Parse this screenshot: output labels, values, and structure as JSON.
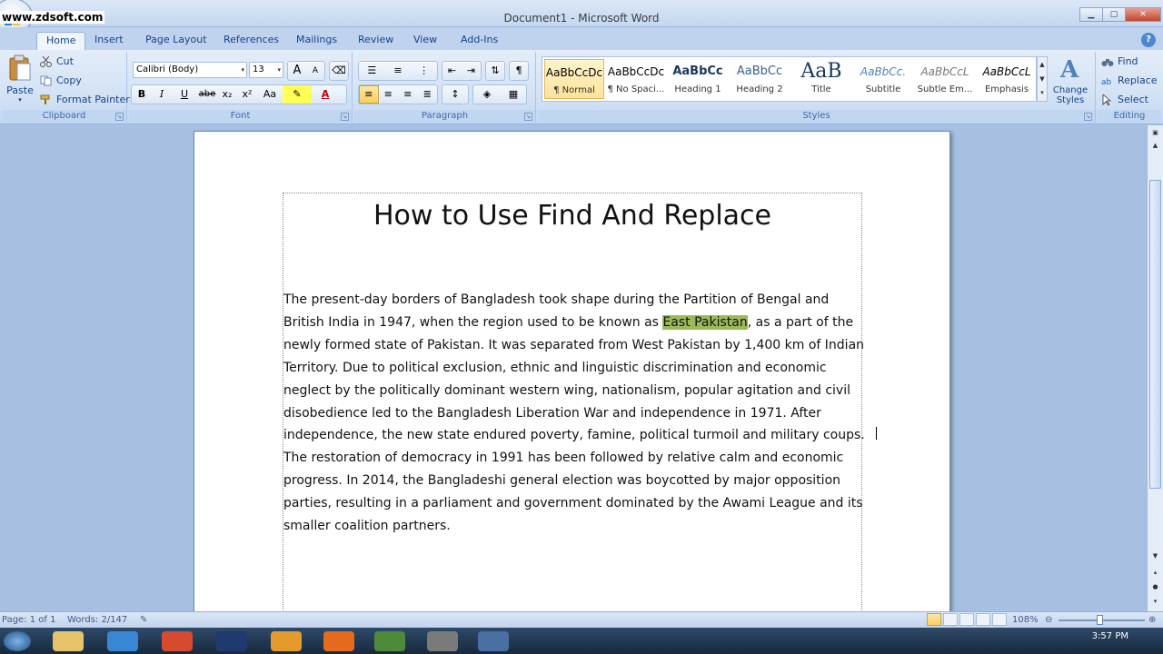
{
  "watermark": "www.zdsoft.com",
  "window": {
    "title": "Document1 - Microsoft Word"
  },
  "tabs": [
    {
      "label": "Home",
      "active": true
    },
    {
      "label": "Insert"
    },
    {
      "label": "Page Layout"
    },
    {
      "label": "References"
    },
    {
      "label": "Mailings"
    },
    {
      "label": "Review"
    },
    {
      "label": "View"
    },
    {
      "label": "Add-Ins"
    }
  ],
  "clipboard": {
    "label": "Clipboard",
    "paste": "Paste",
    "cut": "Cut",
    "copy": "Copy",
    "format_painter": "Format Painter"
  },
  "font": {
    "label": "Font",
    "family": "Calibri (Body)",
    "size": "13",
    "bold": "B",
    "italic": "I",
    "underline": "U",
    "strike": "abe",
    "subscript": "x₂",
    "superscript": "x²",
    "change_case": "Aa",
    "grow": "A",
    "shrink": "A"
  },
  "paragraph": {
    "label": "Paragraph"
  },
  "styles": {
    "label": "Styles",
    "items": [
      {
        "preview": "AaBbCcDc",
        "name": "¶ Normal",
        "active": true
      },
      {
        "preview": "AaBbCcDc",
        "name": "¶ No Spaci..."
      },
      {
        "preview": "AaBbCc",
        "name": "Heading 1"
      },
      {
        "preview": "AaBbCc",
        "name": "Heading 2"
      },
      {
        "preview": "AaB",
        "name": "Title"
      },
      {
        "preview": "AaBbCc.",
        "name": "Subtitle"
      },
      {
        "preview": "AaBbCcL",
        "name": "Subtle Em..."
      },
      {
        "preview": "AaBbCcL",
        "name": "Emphasis"
      }
    ],
    "change_styles": "Change Styles"
  },
  "editing": {
    "label": "Editing",
    "find": "Find",
    "replace": "Replace",
    "select": "Select"
  },
  "document": {
    "heading": "How to Use Find And Replace",
    "para_before": "The present-day borders of Bangladesh took shape during the Partition of Bengal and British India in 1947, when the region used to be known as ",
    "highlight": "East Pakistan",
    "para_after": ", as a part of the newly formed state of Pakistan. It was separated from West Pakistan by 1,400 km of Indian Territory. Due to political exclusion, ethnic and linguistic discrimination and economic neglect by the politically dominant western wing, nationalism, popular agitation and civil disobedience led to the Bangladesh Liberation War and independence in 1971. After independence, the new state endured poverty, famine, political turmoil and military coups. The restoration of democracy in 1991 has been followed by relative calm and economic progress. In 2014, the Bangladeshi general election was boycotted by major opposition parties, resulting in a parliament and government dominated by the Awami League and its smaller coalition partners."
  },
  "status": {
    "page": "Page: 1 of 1",
    "words": "Words: 2/147",
    "zoom": "108%"
  },
  "taskbar": {
    "clock": "3:57 PM"
  }
}
